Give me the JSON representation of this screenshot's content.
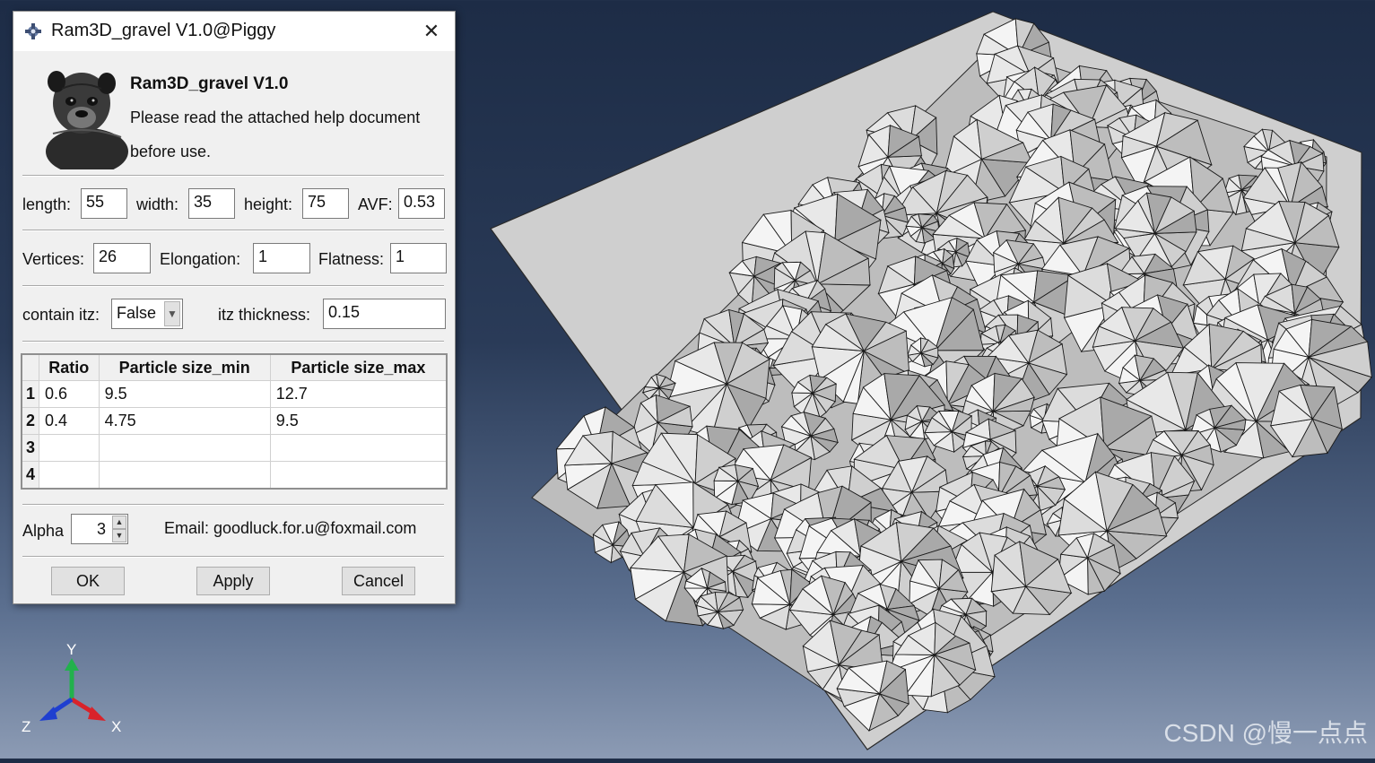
{
  "window": {
    "title": "Ram3D_gravel V1.0@Piggy",
    "close_glyph": "✕",
    "icon": "crosshair-plug-icon"
  },
  "header": {
    "title": "Ram3D_gravel V1.0",
    "line1": "Please read the attached help document",
    "line2": "before use.",
    "image": "pug-dog-photo"
  },
  "dims": {
    "length_label": "length:",
    "length": "55",
    "width_label": "width:",
    "width": "35",
    "height_label": "height:",
    "height": "75",
    "avf_label": "AVF:",
    "avf": "0.53"
  },
  "shape": {
    "vertices_label": "Vertices:",
    "vertices": "26",
    "elongation_label": "Elongation:",
    "elongation": "1",
    "flatness_label": "Flatness:",
    "flatness": "1"
  },
  "itz": {
    "contain_label": "contain itz:",
    "contain_value": "False",
    "thickness_label": "itz thickness:",
    "thickness": "0.15"
  },
  "table": {
    "headers": [
      "Ratio",
      "Particle size_min",
      "Particle size_max"
    ],
    "rows": [
      {
        "num": "1",
        "ratio": "0.6",
        "min": "9.5",
        "max": "12.7"
      },
      {
        "num": "2",
        "ratio": "0.4",
        "min": "4.75",
        "max": "9.5"
      },
      {
        "num": "3",
        "ratio": "",
        "min": "",
        "max": ""
      },
      {
        "num": "4",
        "ratio": "",
        "min": "",
        "max": ""
      }
    ]
  },
  "footer": {
    "alpha_label": "Alpha",
    "alpha_value": "3",
    "email": "Email: goodluck.for.u@foxmail.com"
  },
  "buttons": {
    "ok": "OK",
    "apply": "Apply",
    "cancel": "Cancel"
  },
  "triad": {
    "y": "Y",
    "x": "X",
    "z": "Z",
    "y_color": "#22b14c",
    "x_color": "#d9232a",
    "z_color": "#1f3fd0"
  },
  "watermark": "CSDN @慢一点点",
  "colors": {
    "background_top": "#1d2c46",
    "background_bottom": "#8c9bb4",
    "box_face": "#cfcfcf",
    "particle_light": "#f4f4f4",
    "particle_dark": "#9a9a9a"
  }
}
